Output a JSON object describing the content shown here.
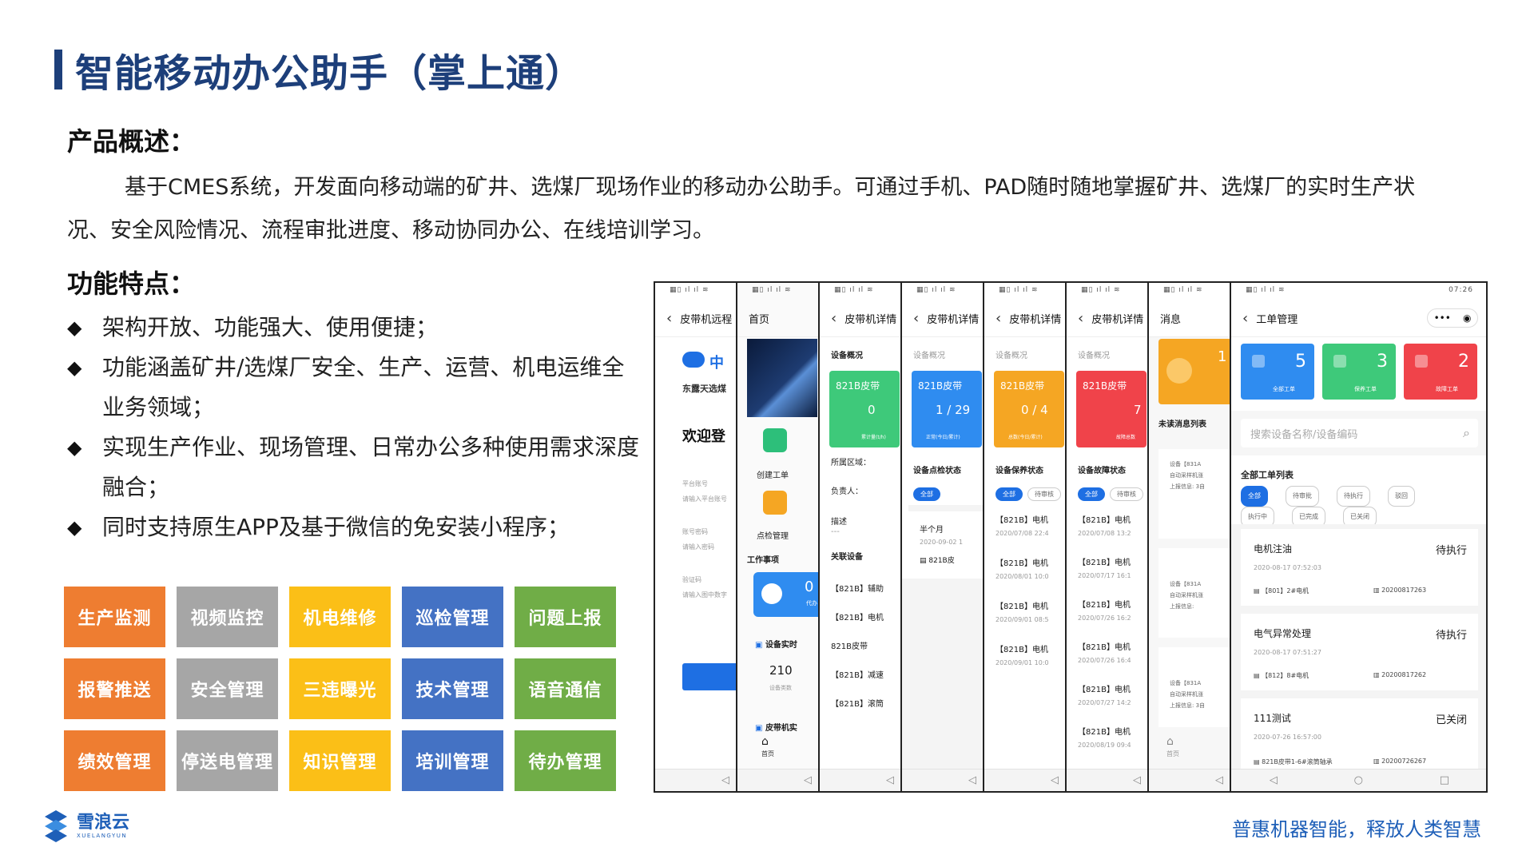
{
  "title": "智能移动办公助手（掌上通）",
  "overview": {
    "heading": "产品概述：",
    "text": "基于CMES系统，开发面向移动端的矿井、选煤厂现场作业的移动办公助手。可通过手机、PAD随时随地掌握矿井、选煤厂的实时生产状况、安全风险情况、流程审批进度、移动协同办公、在线培训学习。"
  },
  "features": {
    "heading": "功能特点：",
    "items": [
      "架构开放、功能强大、使用便捷；",
      "功能涵盖矿井/选煤厂安全、生产、运营、机电运维全业务领域；",
      "实现生产作业、现场管理、日常办公多种使用需求深度融合；",
      "同时支持原生APP及基于微信的免安装小程序；"
    ]
  },
  "modules": [
    {
      "label": "生产监测",
      "color": "orange"
    },
    {
      "label": "视频监控",
      "color": "gray"
    },
    {
      "label": "机电维修",
      "color": "yellow"
    },
    {
      "label": "巡检管理",
      "color": "blue"
    },
    {
      "label": "问题上报",
      "color": "green"
    },
    {
      "label": "报警推送",
      "color": "orange"
    },
    {
      "label": "安全管理",
      "color": "gray"
    },
    {
      "label": "三违曝光",
      "color": "yellow"
    },
    {
      "label": "技术管理",
      "color": "blue"
    },
    {
      "label": "语音通信",
      "color": "green"
    },
    {
      "label": "绩效管理",
      "color": "orange"
    },
    {
      "label": "停送电管理",
      "color": "gray"
    },
    {
      "label": "知识管理",
      "color": "yellow"
    },
    {
      "label": "培训管理",
      "color": "blue"
    },
    {
      "label": "待办管理",
      "color": "green"
    }
  ],
  "brand": {
    "logo_cn": "雪浪云",
    "logo_en": "XUELANGYUN",
    "slogan": "普惠机器智能，释放人类智慧"
  },
  "phones": {
    "p1": {
      "nav": "皮带机远程",
      "company": "东露天选煤",
      "welcome": "欢迎登",
      "field1_label": "平台账号",
      "field1_ph": "请输入平台账号",
      "field2_label": "账号密码",
      "field2_ph": "请输入密码",
      "field3_label": "验证码",
      "field3_ph": "请输入图中数字"
    },
    "p2": {
      "nav": "首页",
      "create": "创建工单",
      "inspect": "点检管理",
      "todo": "工作事项",
      "todo_num": "0",
      "todo_sub": "代办",
      "realtime": "设备实时",
      "count": "210",
      "count_label": "设备类数",
      "belt": "皮带机实",
      "home": "首页"
    },
    "p3": {
      "nav": "皮带机详情",
      "tab": "设备概况",
      "card_title": "821B皮带",
      "card_value": "0",
      "card_sub": "累计量(t/h)",
      "area": "所属区域：",
      "owner": "负责人：",
      "desc": "描述",
      "desc_val": "---",
      "related": "关联设备",
      "items": [
        "【821B】辅助",
        "【821B】电机",
        "821B皮带",
        "【821B】减速",
        "【821B】滚筒"
      ]
    },
    "p4": {
      "nav": "皮带机详情",
      "tab": "设备概况",
      "card_title": "821B皮带",
      "card_value": "1 / 29",
      "card_sub": "正常(今日/累计)",
      "status": "设备点检状态",
      "pill": "全部",
      "half": "半个月",
      "date": "2020-09-02 1",
      "item": "821B皮"
    },
    "p5": {
      "nav": "皮带机详情",
      "tab": "设备概况",
      "card_title": "821B皮带",
      "card_value": "0 / 4",
      "card_sub": "总数(今日/累计)",
      "status": "设备保养状态",
      "pills": [
        "全部",
        "待审核"
      ],
      "rows": [
        {
          "name": "【821B】电机",
          "date": "2020/07/08 22:4"
        },
        {
          "name": "【821B】电机",
          "date": "2020/08/01 10:0"
        },
        {
          "name": "【821B】电机",
          "date": "2020/09/01 08:5"
        },
        {
          "name": "【821B】电机",
          "date": "2020/09/01 10:0"
        }
      ]
    },
    "p6": {
      "nav": "皮带机详情",
      "tab": "设备概况",
      "card_title": "821B皮带",
      "card_value": "7",
      "card_sub": "故障总数",
      "status": "设备故障状态",
      "pills": [
        "全部",
        "待审核"
      ],
      "rows": [
        {
          "name": "【821B】电机",
          "date": "2020/07/08 13:2"
        },
        {
          "name": "【821B】电机",
          "date": "2020/07/17 16:1"
        },
        {
          "name": "【821B】电机",
          "date": "2020/07/26 16:2"
        },
        {
          "name": "【821B】电机",
          "date": "2020/07/26 16:4"
        },
        {
          "name": "【821B】电机",
          "date": "2020/07/27 14:2"
        },
        {
          "name": "【821B】电机",
          "date": "2020/08/19 09:4"
        }
      ]
    },
    "p7": {
      "nav": "消息",
      "unread_num": "1",
      "unread_label": "未读消息列表",
      "msgs": [
        {
          "l1": "设备【831A",
          "l2": "自动采样机涨",
          "l3": "上报信息: 3自"
        },
        {
          "l1": "设备【831A",
          "l2": "自动采样机涨",
          "l3": "上报信息:"
        },
        {
          "l1": "设备【831A",
          "l2": "自动采样机涨",
          "l3": "上报信息: 3自"
        }
      ],
      "home": "首页"
    },
    "p8": {
      "status_right": "07:26",
      "nav": "工单管理",
      "stats": [
        {
          "num": "5",
          "label": "全部工单"
        },
        {
          "num": "3",
          "label": "保养工单"
        },
        {
          "num": "2",
          "label": "故障工单"
        }
      ],
      "search_ph": "搜索设备名称/设备编码",
      "list_title": "全部工单列表",
      "pills": [
        "全部",
        "待审批",
        "待执行",
        "驳回",
        "执行中",
        "已完成",
        "已关闭"
      ],
      "orders": [
        {
          "name": "电机注油",
          "status": "待执行",
          "date": "2020-08-17 07:52:03",
          "device": "【801】2#电机",
          "code": "20200817263"
        },
        {
          "name": "电气异常处理",
          "status": "待执行",
          "date": "2020-08-17 07:51:27",
          "device": "【812】8#电机",
          "code": "20200817262"
        },
        {
          "name": "111测试",
          "status": "已关闭",
          "date": "2020-07-26 16:57:00",
          "device": "821B皮带1-6#滚筒轴承",
          "code": "20200726267"
        }
      ]
    }
  }
}
